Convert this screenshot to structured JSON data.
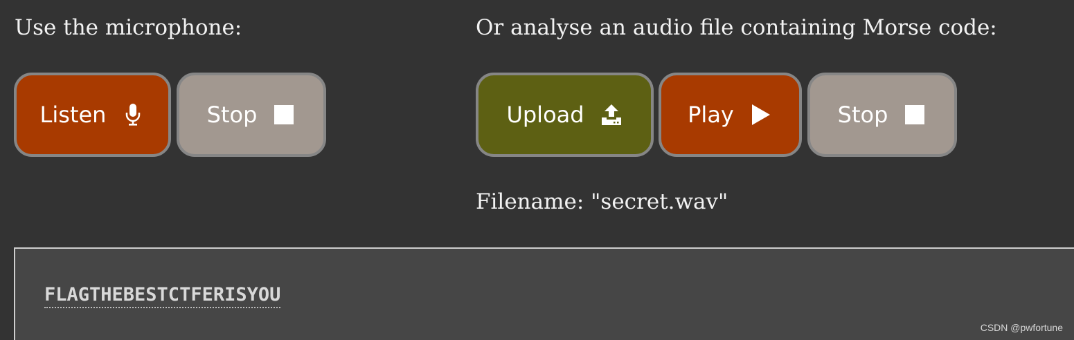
{
  "left_panel": {
    "heading": "Use the microphone:",
    "listen_label": "Listen",
    "listen_icon": "microphone-icon",
    "stop_label": "Stop",
    "stop_icon": "stop-square-icon"
  },
  "right_panel": {
    "heading": "Or analyse an audio file containing Morse code:",
    "upload_label": "Upload",
    "upload_icon": "upload-icon",
    "play_label": "Play",
    "play_icon": "play-icon",
    "stop_label": "Stop",
    "stop_icon": "stop-square-icon",
    "filename_text": "Filename: \"secret.wav\""
  },
  "output": {
    "decoded_text": "FLAGTHEBESTCTFERISYOU"
  },
  "watermark": "CSDN @pwfortune",
  "colors": {
    "background": "#333333",
    "listen_button": "#a83a00",
    "stop_button": "#a29890",
    "upload_button": "#5d6013",
    "play_button": "#a83a00",
    "button_border": "#868686",
    "output_background": "#464646"
  }
}
